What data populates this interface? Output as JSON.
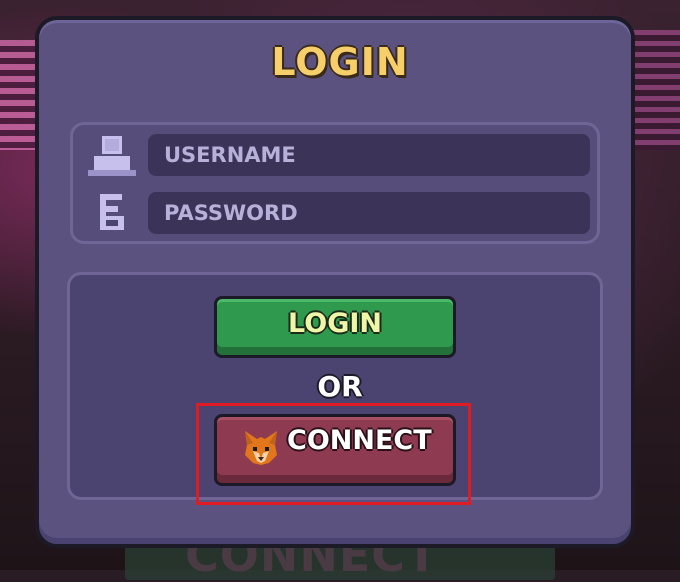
{
  "title": "LOGIN",
  "form": {
    "username_placeholder": "USERNAME",
    "password_placeholder": "PASSWORD"
  },
  "buttons": {
    "login_label": "LOGIN",
    "or_label": "OR",
    "connect_label": "CONNECT"
  },
  "background": {
    "ghost_text": "CONNECT"
  },
  "icons": {
    "username": "user-icon",
    "password": "key-icon",
    "connect": "metamask-fox-icon"
  },
  "colors": {
    "panel": "#5b5280",
    "title": "#f6cf6a",
    "login_button": "#2f9a4d",
    "connect_button": "#8e3a50",
    "highlight": "#e01b24"
  }
}
